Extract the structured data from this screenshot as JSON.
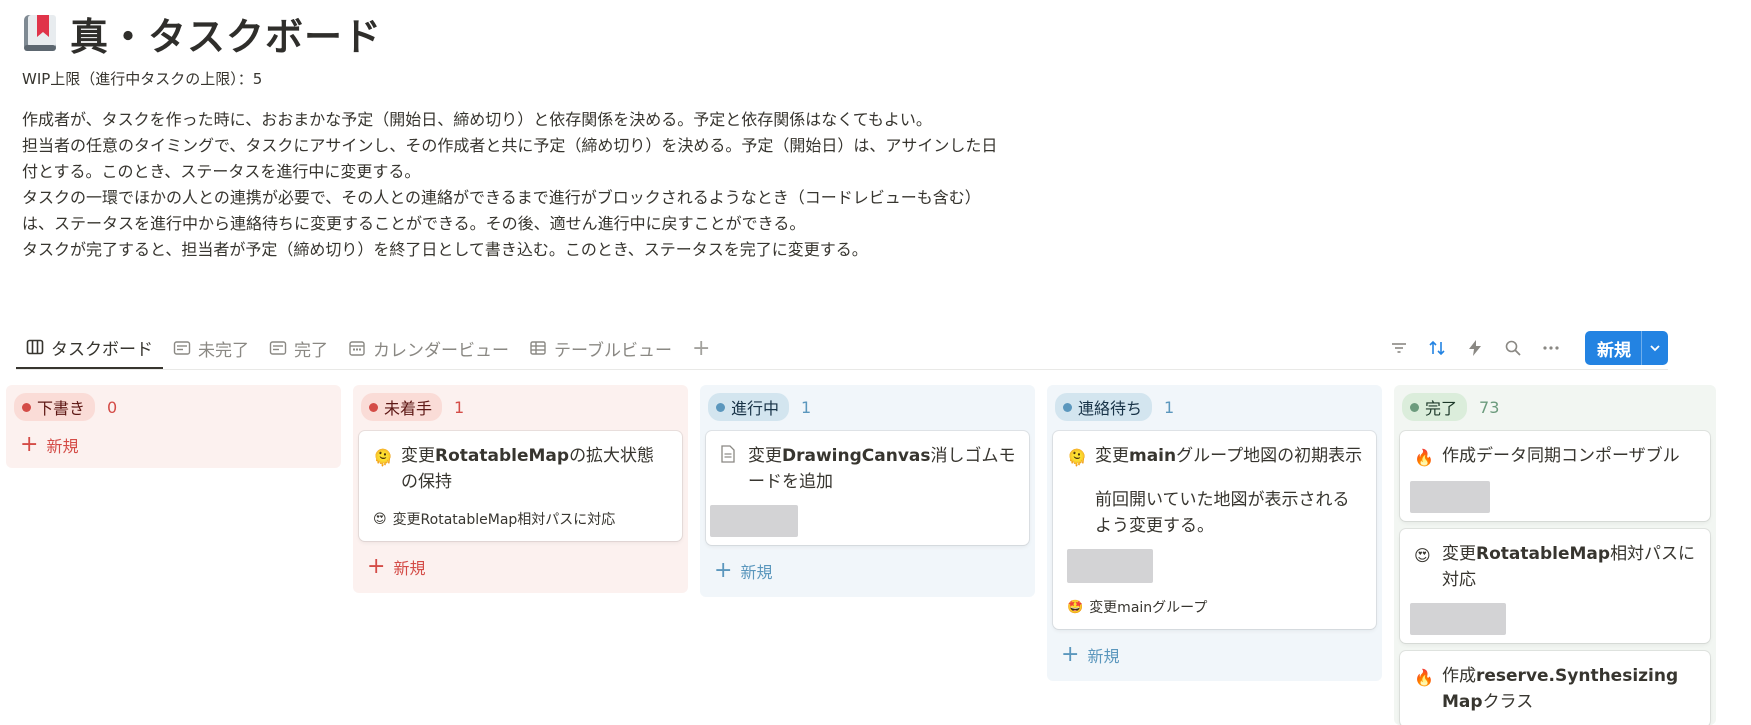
{
  "page": {
    "icon": "bookmark-book-icon",
    "title": "真・タスクボード",
    "wip": "WIP上限（進行中タスクの上限）：5",
    "description": [
      "作成者が、タスクを作った時に、おおまかな予定（開始日、締め切り）と依存関係を決める。予定と依存関係はなくてもよい。",
      "担当者の任意のタイミングで、タスクにアサインし、その作成者と共に予定（締め切り）を決める。予定（開始日）は、アサインした日付とする。このとき、ステータスを進行中に変更する。",
      "タスクの一環でほかの人との連携が必要で、その人との連絡ができるまで進行がブロックされるようなとき（コードレビューも含む）は、ステータスを進行中から連絡待ちに変更することができる。その後、適せん進行中に戻すことができる。",
      "タスクが完了すると、担当者が予定（締め切り）を終了日として書き込む。このとき、ステータスを完了に変更する。"
    ]
  },
  "tabs": [
    {
      "label": "タスクボード",
      "icon": "board-icon",
      "active": true
    },
    {
      "label": "未完了",
      "icon": "list-icon"
    },
    {
      "label": "完了",
      "icon": "list-icon"
    },
    {
      "label": "カレンダービュー",
      "icon": "calendar-icon"
    },
    {
      "label": "テーブルビュー",
      "icon": "table-icon"
    }
  ],
  "toolbar": {
    "new_label": "新規",
    "accent": "#2383e2"
  },
  "columns": [
    {
      "label": "下書き",
      "count": "0",
      "add_label": "新規",
      "color": "#d44c47"
    },
    {
      "label": "未着手",
      "count": "1",
      "add_label": "新規",
      "color": "#d44c47",
      "cards": [
        {
          "icon": "🫠",
          "title_prefix": "変更",
          "title_main": "RotatableMap",
          "title_rest": "の拡大状態の保持",
          "relation_icon": "😍",
          "relation": "変更RotatableMap相対パスに対応"
        }
      ]
    },
    {
      "label": "進行中",
      "count": "1",
      "add_label": "新規",
      "color": "#5b97bd",
      "cards": [
        {
          "icon": "document-icon",
          "title_prefix": "変更",
          "title_main": "DrawingCanvas",
          "title_rest": "消しゴムモードを追加"
        }
      ]
    },
    {
      "label": "連絡待ち",
      "count": "1",
      "add_label": "新規",
      "color": "#5b97bd",
      "cards": [
        {
          "icon": "🫠",
          "title_prefix": "変更",
          "title_main": "main",
          "title_rest": "グループ地図の初期表示",
          "body": "前回開いていた地図が表示されるよう変更する。",
          "relation_icon": "🤩",
          "relation": "変更mainグループ"
        }
      ]
    },
    {
      "label": "完了",
      "count": "73",
      "color": "#6c9b7d",
      "cards": [
        {
          "icon": "🔥",
          "title_prefix": "作成",
          "title_main": "",
          "title_rest": "データ同期コンポーザブル"
        },
        {
          "icon": "😍",
          "title_prefix": "変更",
          "title_main": "RotatableMap",
          "title_rest": "相対パスに対応"
        },
        {
          "icon": "🔥",
          "title_prefix": "作成",
          "title_main": "reserve.Synthesizing Map",
          "title_rest": "クラス"
        }
      ]
    }
  ]
}
